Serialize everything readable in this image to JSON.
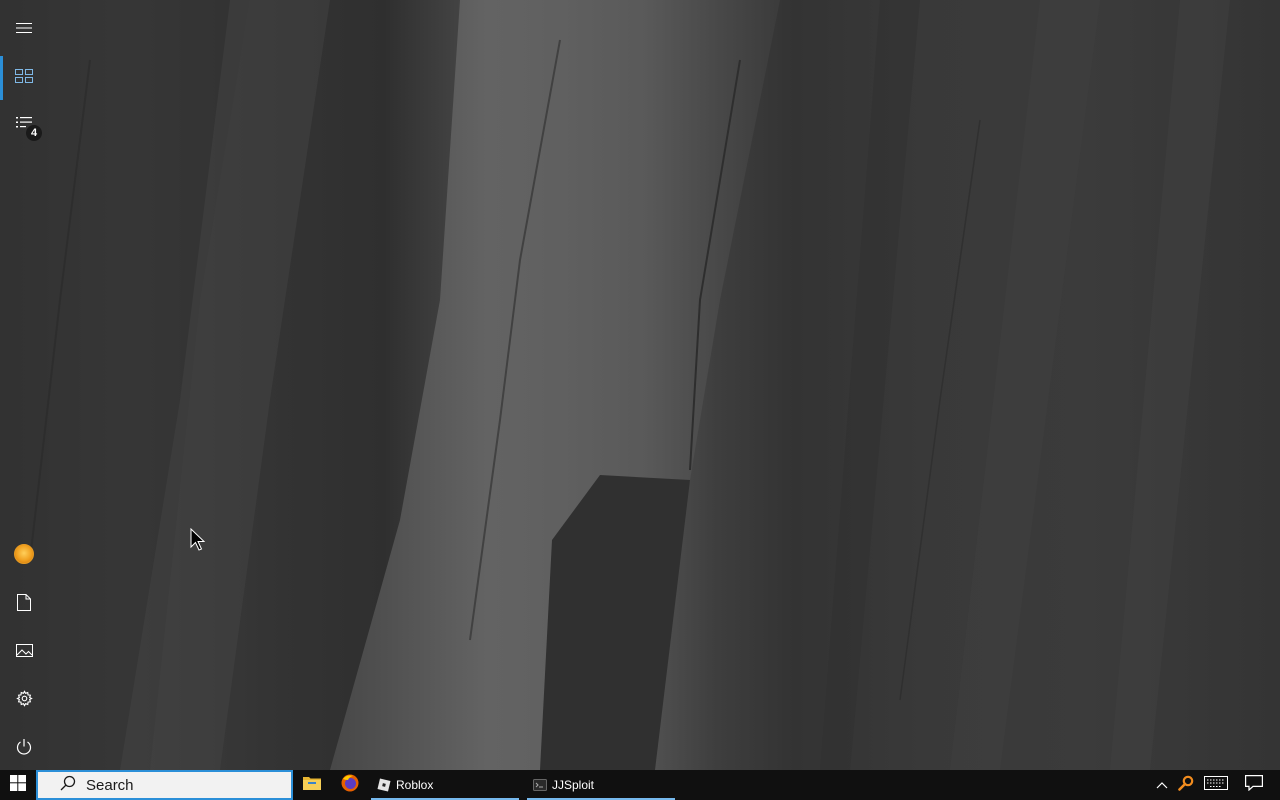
{
  "start_menu": {
    "expand_label": "Expand",
    "tiles_label": "Tiles",
    "apps_label": "All apps",
    "apps_badge": "4",
    "bottom": {
      "user_label": "User",
      "documents_label": "Documents",
      "pictures_label": "Pictures",
      "settings_label": "Settings",
      "power_label": "Power"
    }
  },
  "taskbar": {
    "search": {
      "placeholder": "Search"
    },
    "pinned": [
      {
        "icon": "file-explorer-icon"
      },
      {
        "icon": "firefox-icon"
      }
    ],
    "apps": [
      {
        "label": "Roblox",
        "icon": "roblox-icon",
        "running": true
      },
      {
        "label": "JJSploit",
        "icon": "jjsploit-icon",
        "running": true
      }
    ],
    "tray": [
      {
        "icon": "chevron-up-icon"
      },
      {
        "icon": "search-tool-icon"
      },
      {
        "icon": "keyboard-icon"
      },
      {
        "icon": "notification-icon"
      }
    ]
  },
  "colors": {
    "accent": "#2b8fd8",
    "taskbar_bg": "#101010",
    "running_indicator": "#76b9ed"
  }
}
